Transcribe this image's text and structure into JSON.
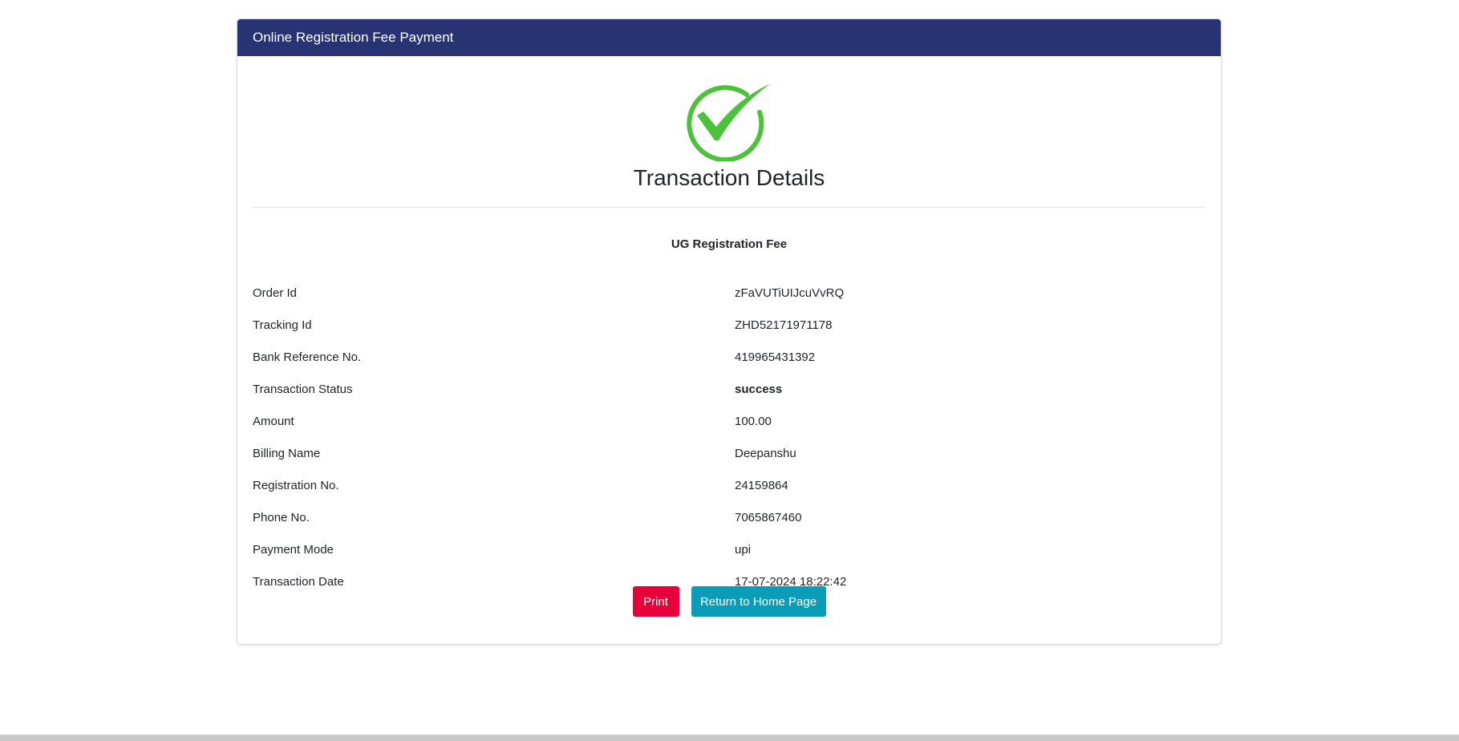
{
  "header": {
    "title": "Online Registration Fee Payment"
  },
  "main": {
    "icon": "check-circle-icon",
    "icon_color": "#4cc13a",
    "title": "Transaction Details",
    "fee_title": "UG Registration Fee",
    "rows": [
      {
        "label": "Order Id",
        "value": "zFaVUTiUIJcuVvRQ"
      },
      {
        "label": "Tracking Id",
        "value": "ZHD52171971178"
      },
      {
        "label": "Bank Reference No.",
        "value": "419965431392"
      },
      {
        "label": "Transaction Status",
        "value": "success"
      },
      {
        "label": "Amount",
        "value": "100.00"
      },
      {
        "label": "Billing Name",
        "value": "Deepanshu"
      },
      {
        "label": "Registration No.",
        "value": "24159864"
      },
      {
        "label": "Phone No.",
        "value": "7065867460"
      },
      {
        "label": "Payment Mode",
        "value": "upi"
      },
      {
        "label": "Transaction Date",
        "value": "17-07-2024 18:22:42"
      }
    ]
  },
  "buttons": {
    "print_label": "Print",
    "home_label": "Return to Home Page"
  },
  "colors": {
    "header_bg": "#283373",
    "print_button": "#e8003a",
    "home_button": "#0b9db8"
  }
}
